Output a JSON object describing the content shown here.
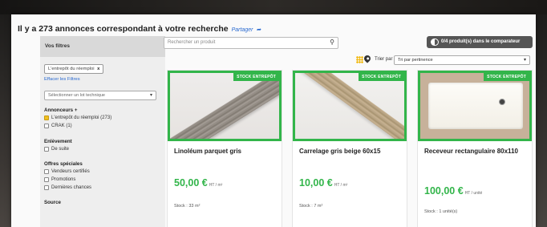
{
  "header": {
    "results_text": "Il y a 273 annonces correspondant à votre recherche",
    "share_link": "Partager"
  },
  "sidebar": {
    "title": "Vos filtres",
    "active_chip": "L'entrepôt du réemploi",
    "chip_close": "x",
    "clear_filters": "Effacer les Filtres",
    "technical_lot_select": "Sélectionner un lot technique",
    "advertisers": {
      "title": "Annonceurs +",
      "options": [
        {
          "label": "L'entrepôt du réemploi (273)",
          "checked": true
        },
        {
          "label": "CRAK (1)",
          "checked": false
        }
      ]
    },
    "pickup": {
      "title": "Enlèvement",
      "options": [
        {
          "label": "De suite",
          "checked": false
        }
      ]
    },
    "special_offers": {
      "title": "Offres spéciales",
      "options": [
        {
          "label": "Vendeurs certifiés",
          "checked": false
        },
        {
          "label": "Promotions",
          "checked": false
        },
        {
          "label": "Dernières chances",
          "checked": false
        }
      ]
    },
    "source": {
      "title": "Source"
    }
  },
  "toolbar": {
    "search_placeholder": "Rechercher un produit",
    "compare_button": "0/4 produit(s) dans le comparateur",
    "sort_label": "Trier par",
    "sort_value": "Tri par pertinence"
  },
  "products": [
    {
      "badge": "STOCK ENTREPÔT",
      "title": "Linoléum parquet gris",
      "price": "50,00 €",
      "unit": "HT / m²",
      "stock": "Stock : 33 m²"
    },
    {
      "badge": "STOCK ENTREPÔT",
      "title": "Carrelage gris beige 60x15",
      "price": "10,00 €",
      "unit": "HT / m²",
      "stock": "Stock : 7 m²"
    },
    {
      "badge": "STOCK ENTREPÔT",
      "title": "Receveur rectangulaire 80x110",
      "price": "100,00 €",
      "unit": "HT / unité",
      "stock": "Stock : 1 unité(s)"
    }
  ],
  "colors": {
    "accent_green": "#32b54a",
    "link_blue": "#2a6ad0",
    "highlight_yellow": "#f0c020"
  }
}
